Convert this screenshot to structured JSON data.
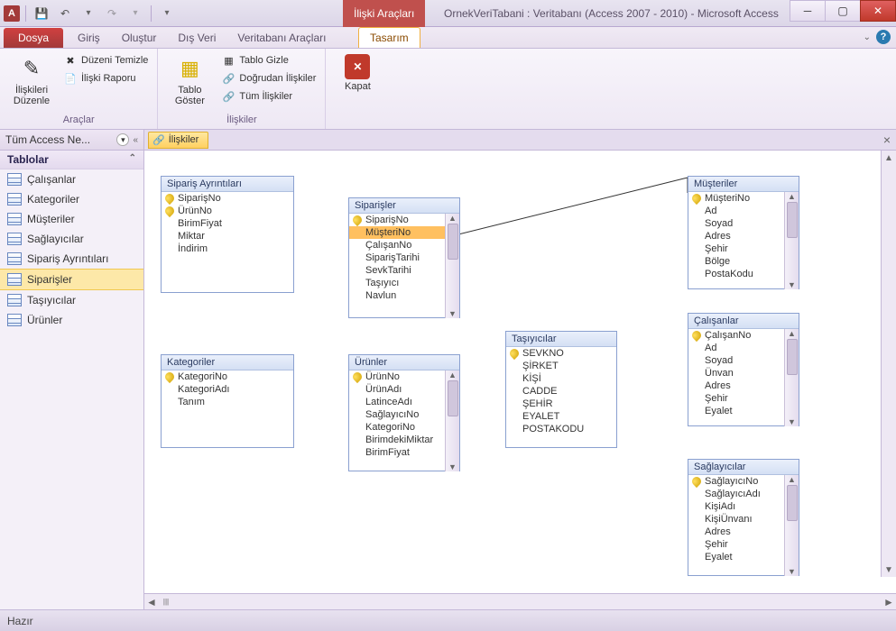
{
  "titlebar": {
    "context_title": "İlişki Araçları",
    "app_title": "OrnekVeriTabani : Veritabanı (Access 2007 - 2010)  -  Microsoft Access"
  },
  "tabs": {
    "file": "Dosya",
    "items": [
      "Giriş",
      "Oluştur",
      "Dış Veri",
      "Veritabanı Araçları"
    ],
    "context_tab": "Tasarım"
  },
  "ribbon": {
    "group1": {
      "edit_rel": "İlişkileri Düzenle",
      "clear_layout": "Düzeni Temizle",
      "rel_report": "İlişki Raporu",
      "label": "Araçlar"
    },
    "group2": {
      "show_table": "Tablo Göster",
      "hide_table": "Tablo Gizle",
      "direct_rel": "Doğrudan İlişkiler",
      "all_rel": "Tüm İlişkiler",
      "label": "İlişkiler"
    },
    "close": "Kapat"
  },
  "nav": {
    "header": "Tüm Access Ne...",
    "group": "Tablolar",
    "items": [
      "Çalışanlar",
      "Kategoriler",
      "Müşteriler",
      "Sağlayıcılar",
      "Sipariş Ayrıntıları",
      "Siparişler",
      "Taşıyıcılar",
      "Ürünler"
    ],
    "selected_index": 5
  },
  "doc_tab": "İlişkiler",
  "tables": {
    "siparis_ayrintilari": {
      "title": "Sipariş Ayrıntıları",
      "fields": [
        {
          "name": "SiparişNo",
          "pk": true
        },
        {
          "name": "ÜrünNo",
          "pk": true
        },
        {
          "name": "BirimFiyat",
          "pk": false
        },
        {
          "name": "Miktar",
          "pk": false
        },
        {
          "name": "İndirim",
          "pk": false
        }
      ]
    },
    "siparisler": {
      "title": "Siparişler",
      "fields": [
        {
          "name": "SiparişNo",
          "pk": true
        },
        {
          "name": "MüşteriNo",
          "pk": false,
          "sel": true
        },
        {
          "name": "ÇalışanNo",
          "pk": false
        },
        {
          "name": "SiparişTarihi",
          "pk": false
        },
        {
          "name": "SevkTarihi",
          "pk": false
        },
        {
          "name": "Taşıyıcı",
          "pk": false
        },
        {
          "name": "Navlun",
          "pk": false
        }
      ]
    },
    "musteriler": {
      "title": "Müşteriler",
      "fields": [
        {
          "name": "MüşteriNo",
          "pk": true
        },
        {
          "name": "Ad",
          "pk": false
        },
        {
          "name": "Soyad",
          "pk": false
        },
        {
          "name": "Adres",
          "pk": false
        },
        {
          "name": "Şehir",
          "pk": false
        },
        {
          "name": "Bölge",
          "pk": false
        },
        {
          "name": "PostaKodu",
          "pk": false
        }
      ]
    },
    "calisanlar": {
      "title": "Çalışanlar",
      "fields": [
        {
          "name": "ÇalışanNo",
          "pk": true
        },
        {
          "name": "Ad",
          "pk": false
        },
        {
          "name": "Soyad",
          "pk": false
        },
        {
          "name": "Ünvan",
          "pk": false
        },
        {
          "name": "Adres",
          "pk": false
        },
        {
          "name": "Şehir",
          "pk": false
        },
        {
          "name": "Eyalet",
          "pk": false
        }
      ]
    },
    "kategoriler": {
      "title": "Kategoriler",
      "fields": [
        {
          "name": "KategoriNo",
          "pk": true
        },
        {
          "name": "KategoriAdı",
          "pk": false
        },
        {
          "name": "Tanım",
          "pk": false
        }
      ]
    },
    "urunler": {
      "title": "Ürünler",
      "fields": [
        {
          "name": "ÜrünNo",
          "pk": true
        },
        {
          "name": "ÜrünAdı",
          "pk": false
        },
        {
          "name": "LatinceAdı",
          "pk": false
        },
        {
          "name": "SağlayıcıNo",
          "pk": false
        },
        {
          "name": "KategoriNo",
          "pk": false
        },
        {
          "name": "BirimdekiMiktar",
          "pk": false
        },
        {
          "name": "BirimFiyat",
          "pk": false
        }
      ]
    },
    "tasiyicilar": {
      "title": "Taşıyıcılar",
      "fields": [
        {
          "name": "SEVKNO",
          "pk": true
        },
        {
          "name": "ŞİRKET",
          "pk": false
        },
        {
          "name": "KİŞİ",
          "pk": false
        },
        {
          "name": "CADDE",
          "pk": false
        },
        {
          "name": "ŞEHİR",
          "pk": false
        },
        {
          "name": "EYALET",
          "pk": false
        },
        {
          "name": "POSTAKODU",
          "pk": false
        }
      ]
    },
    "saglayicilar": {
      "title": "Sağlayıcılar",
      "fields": [
        {
          "name": "SağlayıcıNo",
          "pk": true
        },
        {
          "name": "SağlayıcıAdı",
          "pk": false
        },
        {
          "name": "KişiAdı",
          "pk": false
        },
        {
          "name": "KişiÜnvanı",
          "pk": false
        },
        {
          "name": "Adres",
          "pk": false
        },
        {
          "name": "Şehir",
          "pk": false
        },
        {
          "name": "Eyalet",
          "pk": false
        }
      ]
    }
  },
  "status": "Hazır"
}
